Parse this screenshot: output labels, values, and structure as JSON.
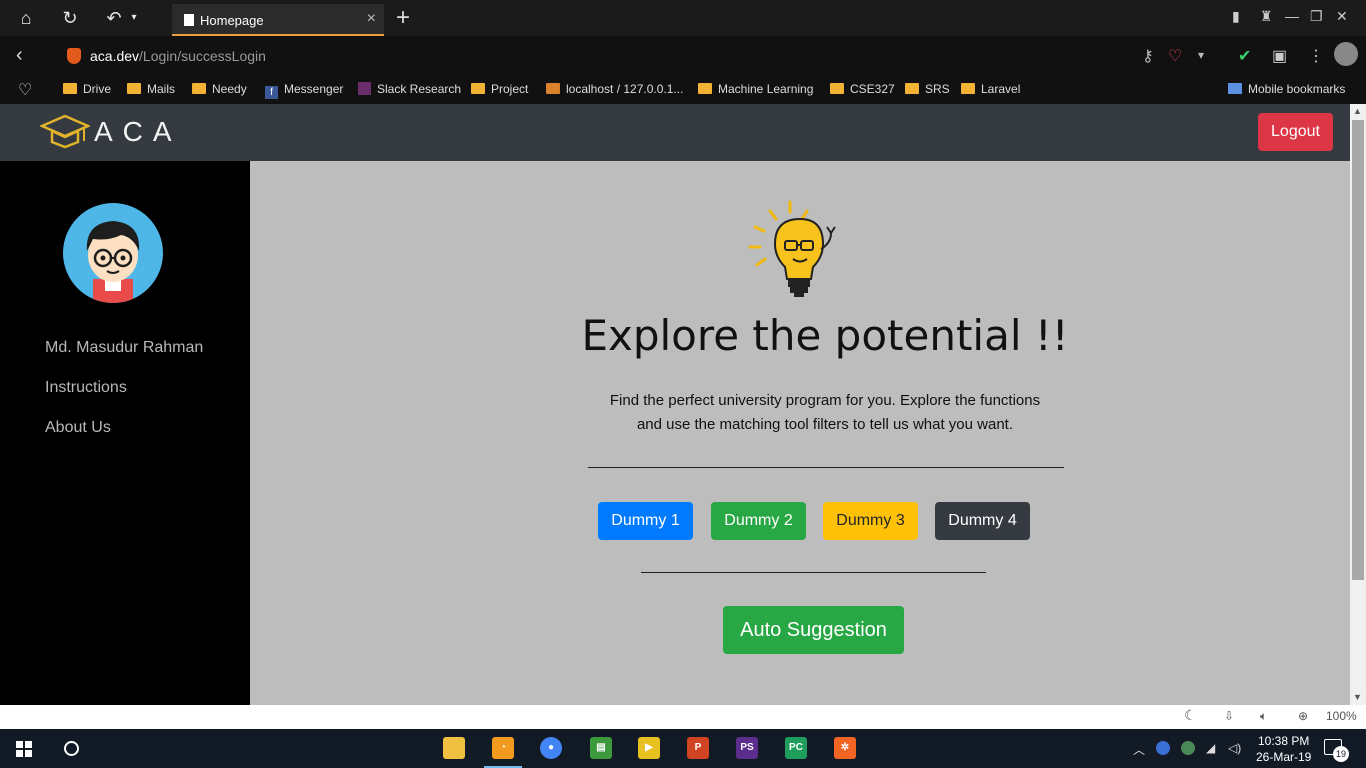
{
  "browser": {
    "tab_title": "Homepage",
    "url_host": "aca.dev",
    "url_path": "/Login/successLogin",
    "bookmarks": [
      "Drive",
      "Mails",
      "Needy",
      "Messenger",
      "Slack Research",
      "Project",
      "localhost / 127.0.0.1...",
      "Machine Learning",
      "CSE327",
      "SRS",
      "Laravel"
    ],
    "mobile_bookmarks": "Mobile bookmarks",
    "zoom": "100%"
  },
  "nav": {
    "logo_text": "ACA",
    "logout_label": "Logout"
  },
  "sidebar": {
    "user_name": "Md. Masudur Rahman",
    "links": [
      "Instructions",
      "About Us"
    ]
  },
  "main": {
    "headline": "Explore the potential !!",
    "description_line1": "Find the perfect university program for you. Explore the functions",
    "description_line2": "and use the matching tool filters to tell us what you want.",
    "buttons": [
      {
        "label": "Dummy 1",
        "bg": "#007bff",
        "fg": "#ffffff"
      },
      {
        "label": "Dummy 2",
        "bg": "#28a745",
        "fg": "#ffffff"
      },
      {
        "label": "Dummy 3",
        "bg": "#ffc107",
        "fg": "#212529"
      },
      {
        "label": "Dummy 4",
        "bg": "#343a40",
        "fg": "#ffffff"
      }
    ],
    "auto_suggestion_label": "Auto Suggestion"
  },
  "taskbar": {
    "time": "10:38 PM",
    "date": "26-Mar-19",
    "notifications": "19"
  }
}
